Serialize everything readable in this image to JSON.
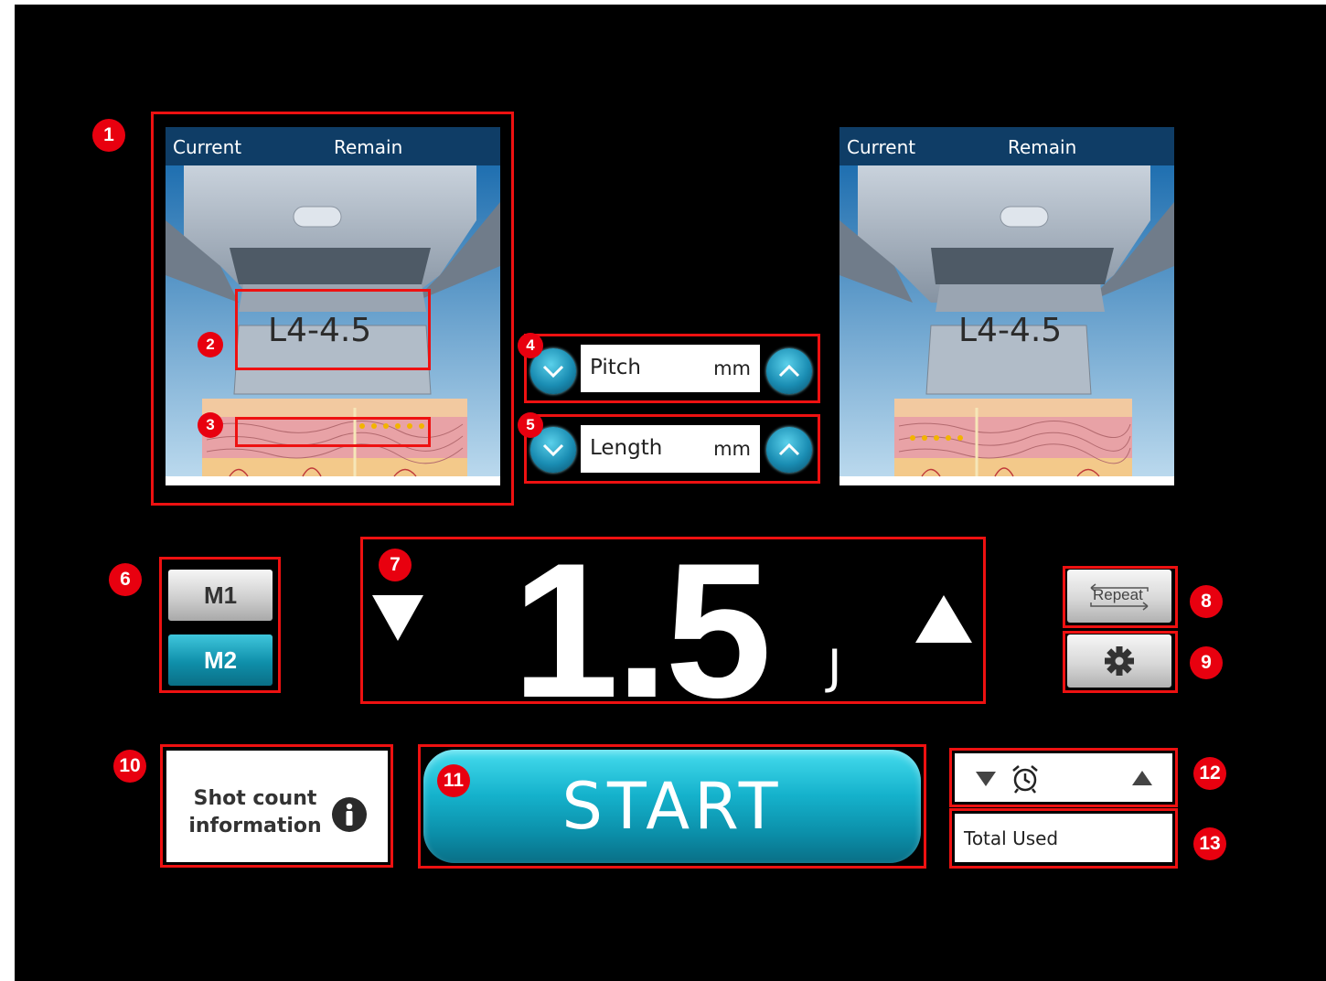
{
  "panels": [
    {
      "current_label": "Current",
      "remain_label": "Remain",
      "cartridge": "L4-4.5"
    },
    {
      "current_label": "Current",
      "remain_label": "Remain",
      "cartridge": "L4-4.5"
    }
  ],
  "pitch": {
    "label": "Pitch",
    "unit": "mm"
  },
  "length": {
    "label": "Length",
    "unit": "mm"
  },
  "modes": [
    {
      "label": "M1",
      "active": false
    },
    {
      "label": "M2",
      "active": true
    }
  ],
  "energy": {
    "value": "1.5",
    "unit": "J"
  },
  "repeat_label": "Repeat",
  "shot_count": {
    "line1": "Shot count",
    "line2": "information"
  },
  "start_label": "START",
  "total_used_label": "Total Used",
  "callouts": [
    "1",
    "2",
    "3",
    "4",
    "5",
    "6",
    "7",
    "8",
    "9",
    "10",
    "11",
    "12",
    "13"
  ],
  "colors": {
    "accent": "#15b2cc",
    "callout": "#e8000f",
    "outline": "#e11111"
  },
  "icons": [
    "chevron-down-icon",
    "chevron-up-icon",
    "triangle-down-icon",
    "triangle-up-icon",
    "gear-icon",
    "info-icon",
    "alarm-clock-icon",
    "repeat-icon"
  ]
}
